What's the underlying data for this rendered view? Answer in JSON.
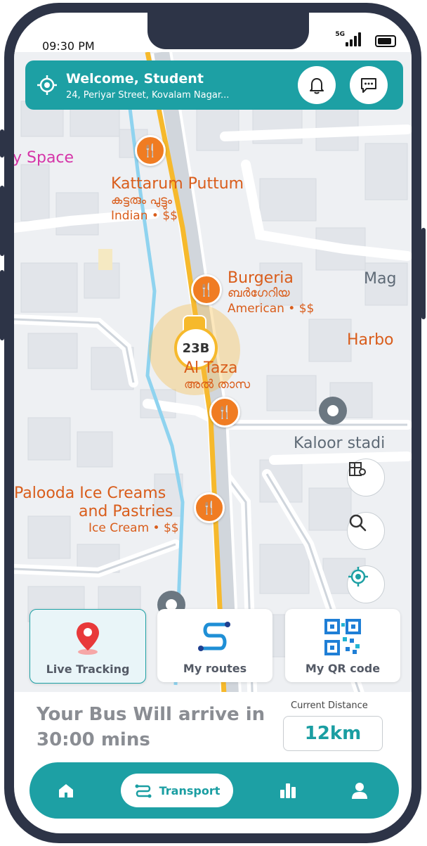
{
  "status_bar": {
    "time": "09:30 PM",
    "network": "5G"
  },
  "header": {
    "title": "Welcome, Student",
    "address": "24, Periyar Street, Kovalam Nagar..."
  },
  "map": {
    "labels": {
      "space": "y Space",
      "kattarum": "Kattarum Puttum",
      "kattarum_ml": "കട്ടരും പുട്ടും",
      "kattarum_sub": "Indian • $$",
      "burgeria": "Burgeria",
      "burgeria_ml": "ബർഗേറിയ",
      "burgeria_sub": "American • $$",
      "mag": "Mag",
      "harbo": "Harbo",
      "taza": "Al Taza",
      "taza_ml": "അൽ താസ",
      "kaloor": "Kaloor stadi",
      "palooda1": "Palooda Ice Creams",
      "palooda2": "and Pastries",
      "palooda_sub": "Ice Cream • $$"
    },
    "bus_number": "23B"
  },
  "quick_actions": [
    {
      "label": "Live Tracking",
      "icon": "location-pin-icon",
      "active": true
    },
    {
      "label": "My routes",
      "icon": "route-icon",
      "active": false
    },
    {
      "label": "My QR code",
      "icon": "qr-code-icon",
      "active": false
    }
  ],
  "arrival": {
    "message": "Your Bus Will arrive in 30:00 mins",
    "distance_label": "Current Distance",
    "distance_value": "12km"
  },
  "bottom_nav": {
    "active_label": "Transport",
    "items": [
      "home-icon",
      "transport-icon",
      "stats-icon",
      "profile-icon"
    ]
  },
  "colors": {
    "primary": "#1da0a4",
    "route": "#f6b92c",
    "poi": "#d95d1b"
  }
}
